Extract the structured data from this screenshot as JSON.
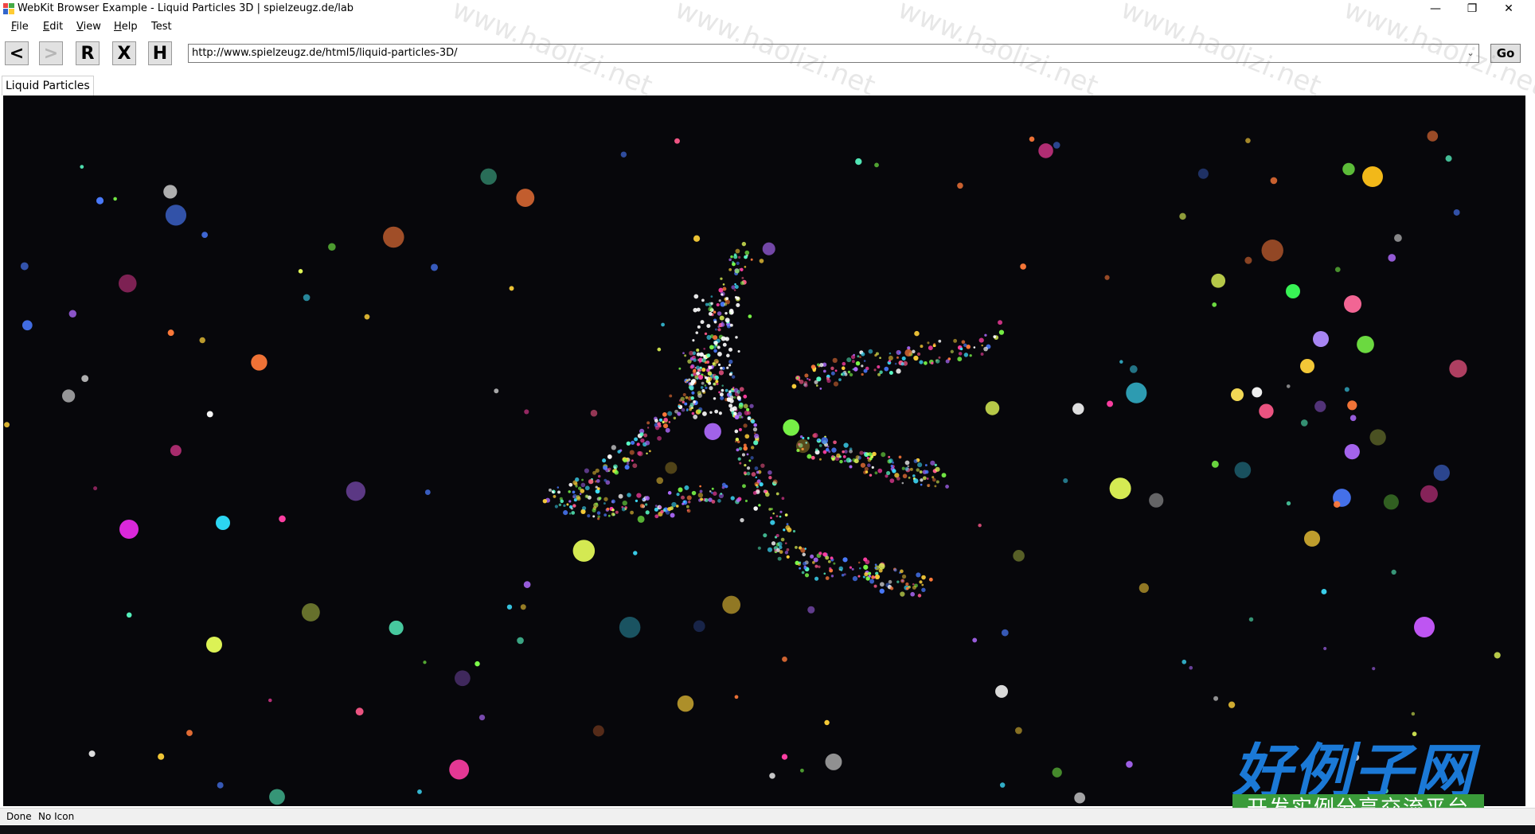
{
  "window": {
    "title": "WebKit Browser Example - Liquid Particles 3D | spielzeugz.de/lab",
    "minimize_glyph": "—",
    "restore_glyph": "❐",
    "close_glyph": "✕"
  },
  "menu": {
    "items": [
      {
        "mnemonic": "F",
        "rest": "ile"
      },
      {
        "mnemonic": "E",
        "rest": "dit"
      },
      {
        "mnemonic": "V",
        "rest": "iew"
      },
      {
        "mnemonic": "H",
        "rest": "elp"
      },
      {
        "mnemonic": "",
        "rest": "Test"
      }
    ]
  },
  "toolbar": {
    "back_label": "<",
    "forward_label": ">",
    "reload_label": "R",
    "stop_label": "X",
    "home_label": "H",
    "url": "http://www.spielzeugz.de/html5/liquid-particles-3D/",
    "go_label": "Go"
  },
  "tab": {
    "label": "Liquid Particles"
  },
  "status": {
    "text": "Done",
    "icon_text": "No Icon"
  },
  "watermark": {
    "main": "好例子网",
    "sub": "开发实例分享交流平台",
    "diagonal": "www.haolizi.net"
  },
  "colors": {
    "canvas_bg": "#07070b",
    "watermark_blue": "#1b79d6",
    "watermark_green": "#3a9b3a"
  }
}
